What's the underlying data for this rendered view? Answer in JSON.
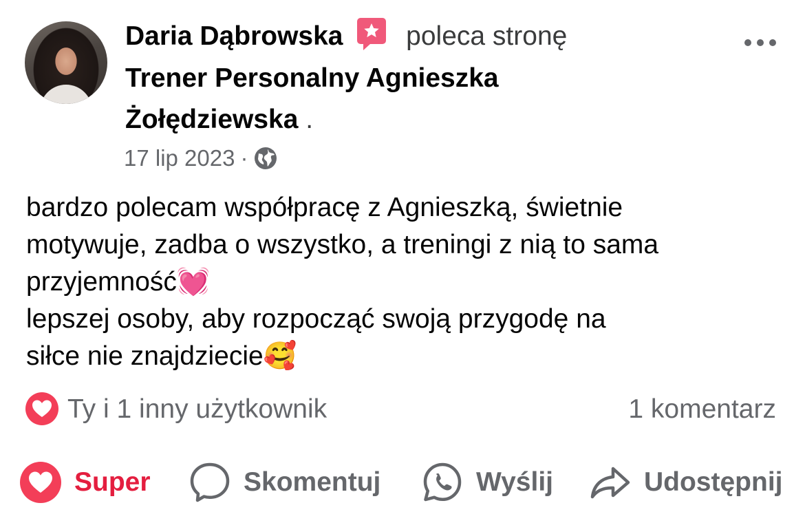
{
  "post": {
    "author": "Daria Dąbrowska",
    "action_text": "poleca stronę",
    "page_name_line1": "Trener Personalny Agnieszka",
    "page_name_line2": "Żołędziewska",
    "page_name_suffix": ".",
    "date": "17 lip 2023",
    "separator": "·",
    "privacy_icon": "globe-icon",
    "body_line1": "bardzo polecam współpracę z Agnieszką, świetnie",
    "body_line2": "motywuje, zadba o wszystko, a treningi z nią to sama",
    "body_line3": "przyjemność",
    "emoji1": "💓",
    "body_line4": "lepszej osoby, aby rozpocząć swoją przygodę na",
    "body_line5": "siłce nie znajdziecie",
    "emoji2": "🥰"
  },
  "stats": {
    "reactors": "Ty i 1 inny użytkownik",
    "comments": "1 komentarz"
  },
  "actions": {
    "like": "Super",
    "comment": "Skomentuj",
    "send": "Wyślij",
    "share": "Udostępnij"
  },
  "colors": {
    "accent_red": "#e41e3f",
    "muted_gray": "#65676b",
    "recommend_badge": "#f0597a"
  }
}
